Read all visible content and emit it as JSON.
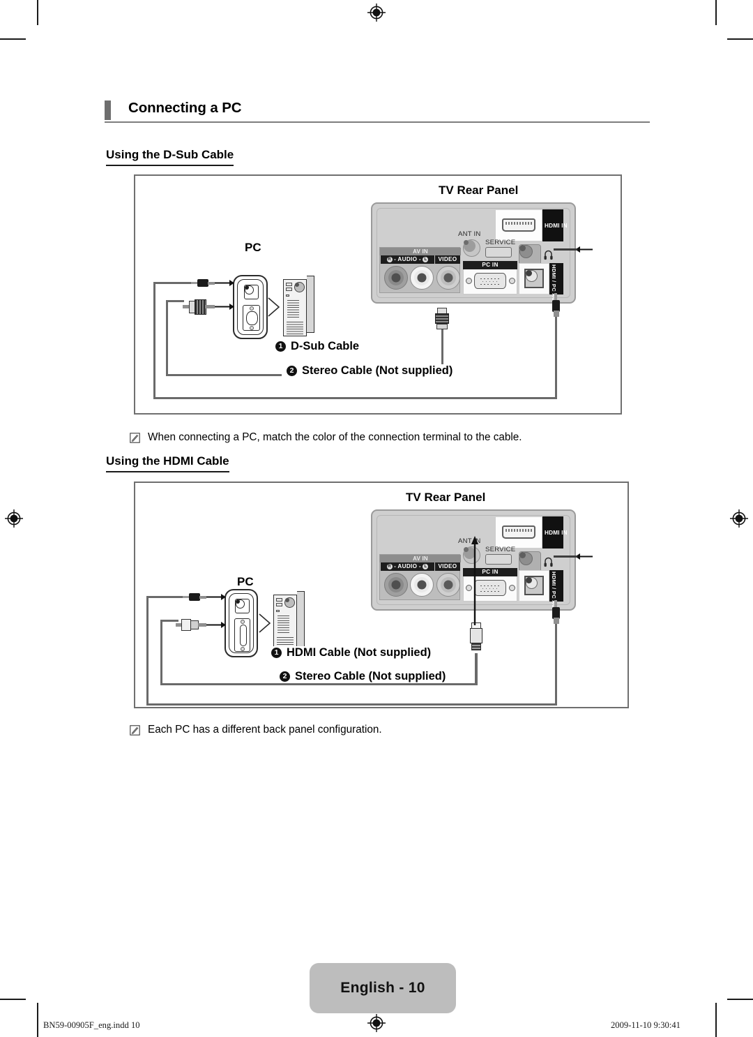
{
  "document": {
    "chapter_title": "Connecting a PC",
    "page_badge": "English - 10",
    "footer_left": "BN59-00905F_eng.indd  10",
    "footer_right": "2009-11-10   9:30:41",
    "colors": {
      "accent_bar": "#6e6e6e",
      "rule": "#7d7d7d",
      "panel_body": "#cfcfcf",
      "panel_dark": "#1d1d1d",
      "wire": "#6a6a6a",
      "badge": "#bdbdbd"
    }
  },
  "sections": [
    {
      "heading": "Using the D-Sub Cable",
      "diagram": {
        "title": "TV Rear Panel",
        "pc_label": "PC",
        "captions": [
          {
            "num": "1",
            "text": "D-Sub Cable"
          },
          {
            "num": "2",
            "text": "Stereo Cable (Not supplied)"
          }
        ],
        "tv_ports": {
          "hdmi_in": "HDMI IN",
          "ant_in": "ANT IN",
          "service": "SERVICE",
          "av_in": "AV IN",
          "av_audio": "- AUDIO -",
          "av_audio_r": "R",
          "av_audio_l": "L",
          "av_video": "VIDEO",
          "pc_in": "PC IN",
          "audio_in": "HDMI / PC AUDIO IN"
        }
      },
      "note": {
        "icon": "note-pencil-icon",
        "text": "When connecting a PC, match the color of the connection terminal to the cable."
      }
    },
    {
      "heading": "Using the HDMI Cable",
      "diagram": {
        "title": "TV Rear Panel",
        "pc_label": "PC",
        "captions": [
          {
            "num": "1",
            "text": "HDMI Cable (Not supplied)"
          },
          {
            "num": "2",
            "text": "Stereo Cable (Not supplied)"
          }
        ],
        "tv_ports": {
          "hdmi_in": "HDMI IN",
          "ant_in": "ANT IN",
          "service": "SERVICE",
          "av_in": "AV IN",
          "av_audio": "- AUDIO -",
          "av_audio_r": "R",
          "av_audio_l": "L",
          "av_video": "VIDEO",
          "pc_in": "PC IN",
          "audio_in": "HDMI / PC AUDIO IN"
        }
      },
      "note": {
        "icon": "note-pencil-icon",
        "text": "Each PC has a different back panel configuration."
      }
    }
  ]
}
